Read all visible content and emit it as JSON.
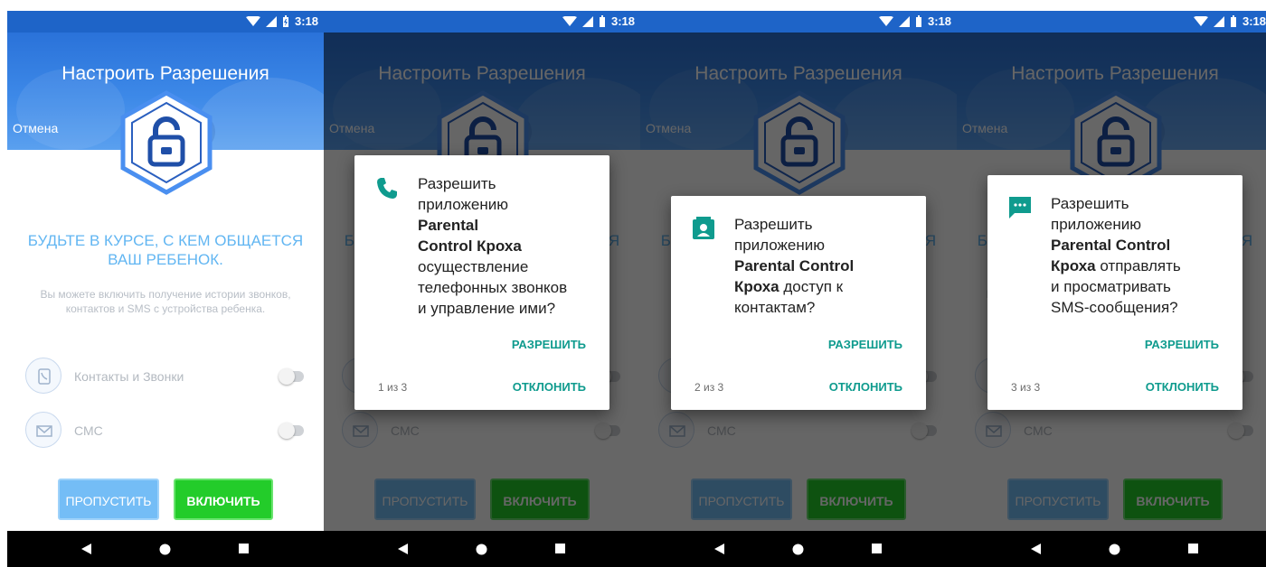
{
  "status": {
    "time": "3:18"
  },
  "screen": {
    "title": "Настроить Разрешения",
    "cancel": "Отмена",
    "headline": "БУДЬТЕ В КУРСЕ, С КЕМ ОБЩАЕТСЯ ВАШ РЕБЕНОК.",
    "description": "Вы можете включить получение истории звонков, контактов и SMS с устройства ребенка.",
    "permissions": [
      {
        "label": "Контакты и Звонки",
        "icon": "contacts-phone-icon",
        "enabled": false
      },
      {
        "label": "СМС",
        "icon": "envelope-icon",
        "enabled": false
      }
    ],
    "skip_label": "ПРОПУСТИТЬ",
    "enable_label": "ВКЛЮЧИТЬ"
  },
  "dialogs": [
    {
      "icon": "phone-icon",
      "line1": "Разрешить",
      "line2": "приложению",
      "bold1": "Parental",
      "bold2": "Control Кроха",
      "rest1": "осуществление",
      "rest2": "телефонных звонков",
      "rest3": "и управление ими?",
      "allow": "РАЗРЕШИТЬ",
      "deny": "ОТКЛОНИТЬ",
      "counter": "1 из 3"
    },
    {
      "icon": "contacts-icon",
      "line1": "Разрешить",
      "line2": "приложению",
      "bold1": "Parental Control",
      "bold2": "Кроха",
      "rest1": " доступ к",
      "rest2": "контактам?",
      "allow": "РАЗРЕШИТЬ",
      "deny": "ОТКЛОНИТЬ",
      "counter": "2 из 3"
    },
    {
      "icon": "sms-icon",
      "line1": "Разрешить",
      "line2": "приложению",
      "bold1": "Parental Control",
      "bold2": "Кроха",
      "rest1": " отправлять",
      "rest2": "и просматривать",
      "rest3": "SMS-сообщения?",
      "allow": "РАЗРЕШИТЬ",
      "deny": "ОТКЛОНИТЬ",
      "counter": "3 из 3"
    }
  ],
  "colors": {
    "accent": "#0f9b8e",
    "header": "#2a72d9",
    "enable": "#23cc2a",
    "skip": "#74bdf6"
  }
}
